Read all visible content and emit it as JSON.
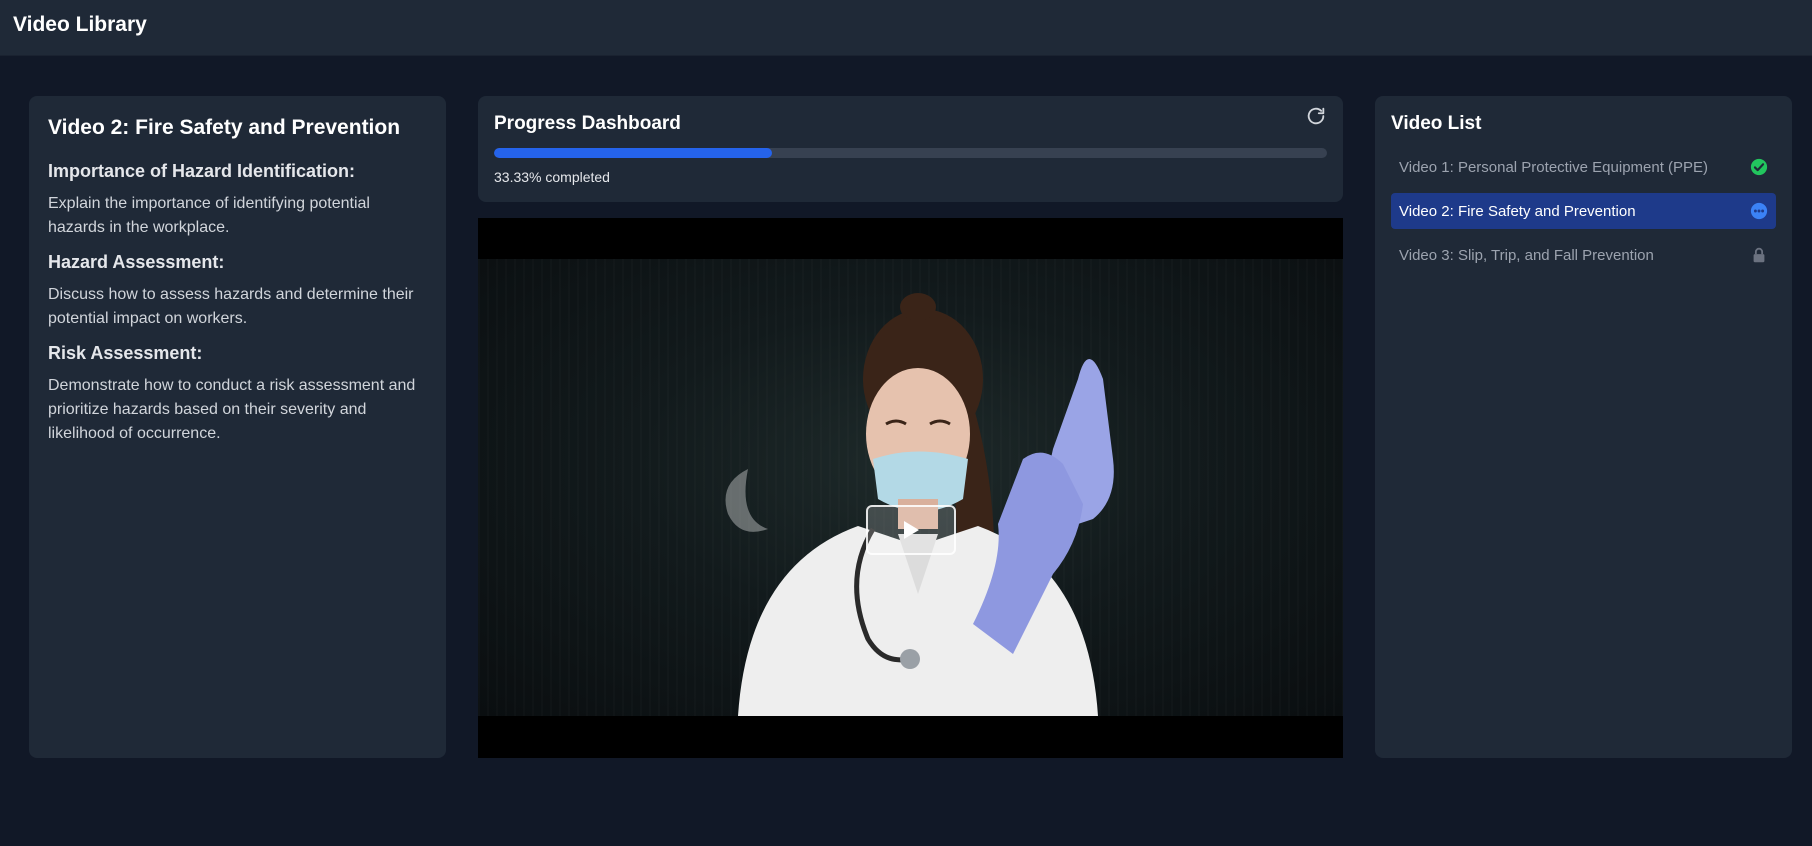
{
  "app": {
    "title": "Video Library"
  },
  "lesson": {
    "title": "Video 2: Fire Safety and Prevention",
    "sections": [
      {
        "heading": "Importance of Hazard Identification:",
        "body": "Explain the importance of identifying potential hazards in the workplace."
      },
      {
        "heading": "Hazard Assessment:",
        "body": "Discuss how to assess hazards and determine their potential impact on workers."
      },
      {
        "heading": "Risk Assessment:",
        "body": "Demonstrate how to conduct a risk assessment and prioritize hazards based on their severity and likelihood of occurrence."
      }
    ]
  },
  "progress": {
    "title": "Progress Dashboard",
    "percent": 33.33,
    "label": "33.33% completed",
    "refresh_icon": "refresh-icon",
    "fill_color": "#2563eb"
  },
  "player": {
    "play_icon": "play-icon"
  },
  "video_list": {
    "title": "Video List",
    "items": [
      {
        "label": "Video 1: Personal Protective Equipment (PPE)",
        "status": "completed",
        "icon": "check-circle-icon",
        "color": "#22c55e"
      },
      {
        "label": "Video 2: Fire Safety and Prevention",
        "status": "in-progress",
        "icon": "ellipsis-circle-icon",
        "color": "#3b82f6"
      },
      {
        "label": "Video 3: Slip, Trip, and Fall Prevention",
        "status": "locked",
        "icon": "lock-icon",
        "color": "#6b7280"
      }
    ]
  }
}
